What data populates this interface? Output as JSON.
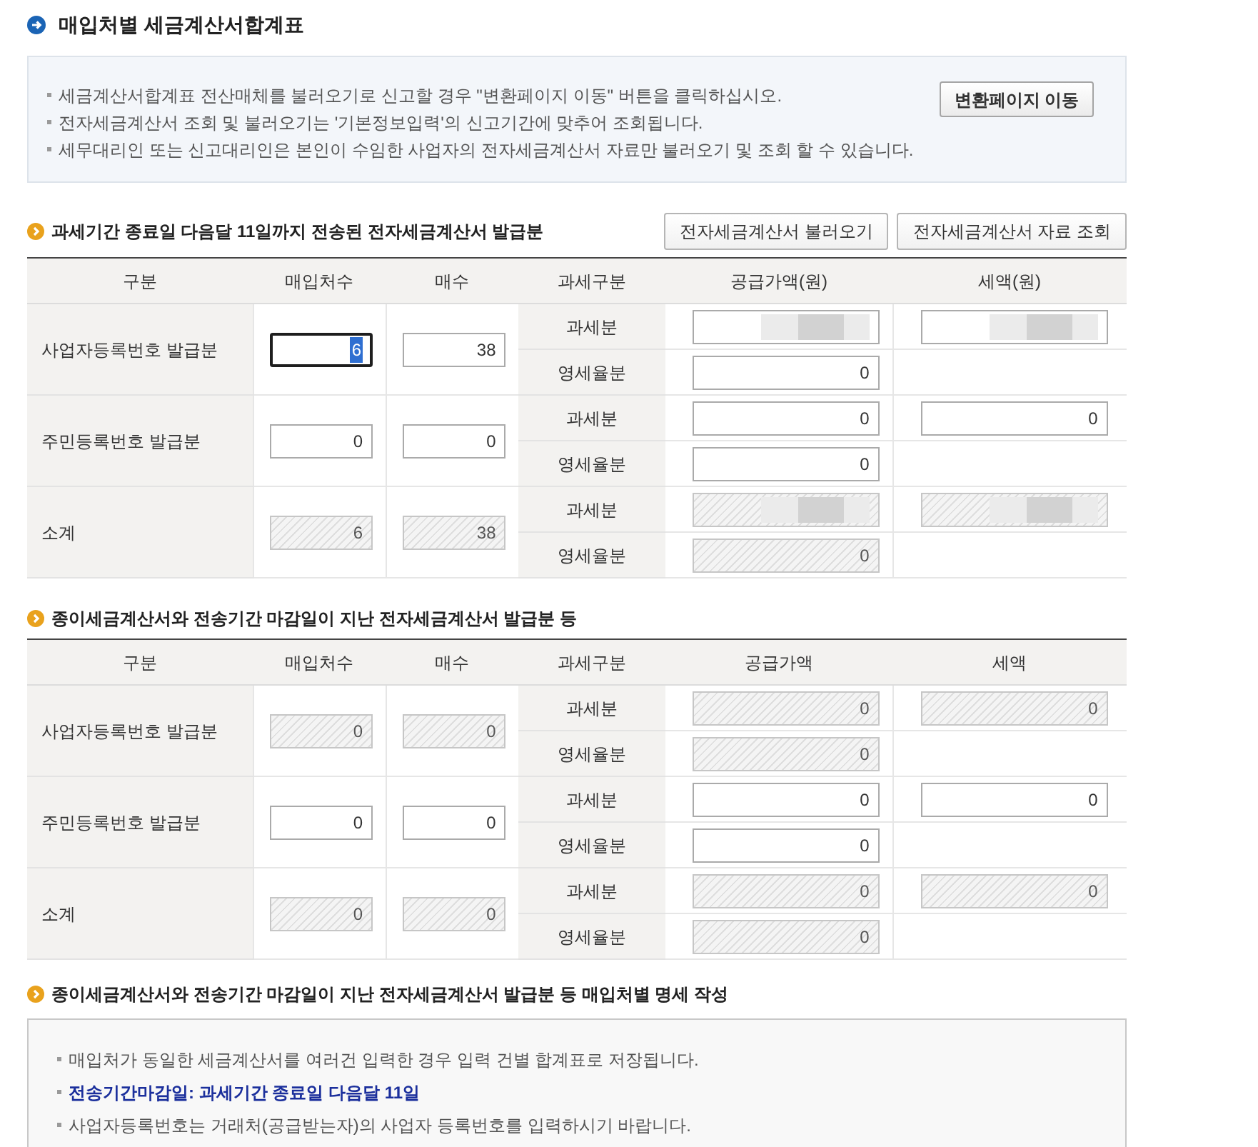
{
  "page": {
    "title": "매입처별 세금계산서합계표"
  },
  "notice": {
    "items": [
      "세금계산서합계표 전산매체를 불러오기로 신고할 경우 \"변환페이지 이동\" 버튼을 클릭하십시오.",
      "전자세금계산서 조회 및 불러오기는 '기본정보입력'의 신고기간에 맞추어 조회됩니다.",
      "세무대리인 또는 신고대리인은 본인이 수임한 사업자의 전자세금계산서 자료만 불러오기 및 조회 할 수 있습니다."
    ],
    "button": "변환페이지 이동"
  },
  "sections": [
    {
      "heading": "과세기간 종료일 다음달 11일까지 전송된 전자세금계산서 발급분",
      "buttons": [
        "전자세금계산서 불러오기",
        "전자세금계산서 자료 조회"
      ],
      "table": {
        "columns": [
          "구분",
          "매입처수",
          "매수",
          "과세구분",
          "공급가액(원)",
          "세액(원)"
        ],
        "rows": [
          {
            "label": "사업자등록번호 발급분",
            "suppliers": {
              "value": "6",
              "disabled": false,
              "focused": true,
              "redacted": false
            },
            "sheets": {
              "value": "38",
              "disabled": false,
              "focused": false,
              "redacted": false
            },
            "sub_rows": [
              {
                "type": "과세분",
                "supply": {
                  "disabled": false,
                  "focused": false,
                  "redacted": true
                },
                "tax": {
                  "disabled": false,
                  "focused": false,
                  "redacted": true
                }
              },
              {
                "type": "영세율분",
                "supply": {
                  "value": "0",
                  "disabled": false,
                  "focused": false,
                  "redacted": false
                }
              }
            ]
          },
          {
            "label": "주민등록번호 발급분",
            "suppliers": {
              "value": "0",
              "disabled": false,
              "focused": false,
              "redacted": false
            },
            "sheets": {
              "value": "0",
              "disabled": false,
              "focused": false,
              "redacted": false
            },
            "sub_rows": [
              {
                "type": "과세분",
                "supply": {
                  "value": "0",
                  "disabled": false,
                  "focused": false,
                  "redacted": false
                },
                "tax": {
                  "value": "0",
                  "disabled": false,
                  "focused": false,
                  "redacted": false
                }
              },
              {
                "type": "영세율분",
                "supply": {
                  "value": "0",
                  "disabled": false,
                  "focused": false,
                  "redacted": false
                }
              }
            ]
          },
          {
            "label": "소계",
            "suppliers": {
              "value": "6",
              "disabled": true,
              "focused": false,
              "redacted": false
            },
            "sheets": {
              "value": "38",
              "disabled": true,
              "focused": false,
              "redacted": false
            },
            "sub_rows": [
              {
                "type": "과세분",
                "supply": {
                  "disabled": true,
                  "focused": false,
                  "redacted": true
                },
                "tax": {
                  "disabled": true,
                  "focused": false,
                  "redacted": true
                }
              },
              {
                "type": "영세율분",
                "supply": {
                  "value": "0",
                  "disabled": true,
                  "focused": false,
                  "redacted": false
                }
              }
            ]
          }
        ]
      }
    },
    {
      "heading": "종이세금계산서와 전송기간 마감일이 지난 전자세금계산서 발급분 등",
      "table": {
        "columns": [
          "구분",
          "매입처수",
          "매수",
          "과세구분",
          "공급가액",
          "세액"
        ],
        "rows": [
          {
            "label": "사업자등록번호 발급분",
            "suppliers": {
              "value": "0",
              "disabled": true,
              "focused": false,
              "redacted": false
            },
            "sheets": {
              "value": "0",
              "disabled": true,
              "focused": false,
              "redacted": false
            },
            "sub_rows": [
              {
                "type": "과세분",
                "supply": {
                  "value": "0",
                  "disabled": true,
                  "focused": false,
                  "redacted": false
                },
                "tax": {
                  "value": "0",
                  "disabled": true,
                  "focused": false,
                  "redacted": false
                }
              },
              {
                "type": "영세율분",
                "supply": {
                  "value": "0",
                  "disabled": true,
                  "focused": false,
                  "redacted": false
                }
              }
            ]
          },
          {
            "label": "주민등록번호 발급분",
            "suppliers": {
              "value": "0",
              "disabled": false,
              "focused": false,
              "redacted": false
            },
            "sheets": {
              "value": "0",
              "disabled": false,
              "focused": false,
              "redacted": false
            },
            "sub_rows": [
              {
                "type": "과세분",
                "supply": {
                  "value": "0",
                  "disabled": false,
                  "focused": false,
                  "redacted": false
                },
                "tax": {
                  "value": "0",
                  "disabled": false,
                  "focused": false,
                  "redacted": false
                }
              },
              {
                "type": "영세율분",
                "supply": {
                  "value": "0",
                  "disabled": false,
                  "focused": false,
                  "redacted": false
                }
              }
            ]
          },
          {
            "label": "소계",
            "suppliers": {
              "value": "0",
              "disabled": true,
              "focused": false,
              "redacted": false
            },
            "sheets": {
              "value": "0",
              "disabled": true,
              "focused": false,
              "redacted": false
            },
            "sub_rows": [
              {
                "type": "과세분",
                "supply": {
                  "value": "0",
                  "disabled": true,
                  "focused": false,
                  "redacted": false
                },
                "tax": {
                  "value": "0",
                  "disabled": true,
                  "focused": false,
                  "redacted": false
                }
              },
              {
                "type": "영세율분",
                "supply": {
                  "value": "0",
                  "disabled": true,
                  "focused": false,
                  "redacted": false
                }
              }
            ]
          }
        ]
      }
    }
  ],
  "detail": {
    "heading": "종이세금계산서와 전송기간 마감일이 지난 전자세금계산서 발급분 등 매입처별 명세 작성",
    "notes": [
      {
        "kind": "plain",
        "text": "매입처가 동일한 세금계산서를 여러건 입력한 경우 입력 건별 합계표로 저장됩니다."
      },
      {
        "kind": "emphasis",
        "text": "전송기간마감일: 과세기간 종료일 다음달 11일"
      },
      {
        "kind": "plain",
        "text": "사업자등록번호는 거래처(공급받는자)의 사업자 등록번호를 입력하시기 바랍니다."
      }
    ]
  }
}
